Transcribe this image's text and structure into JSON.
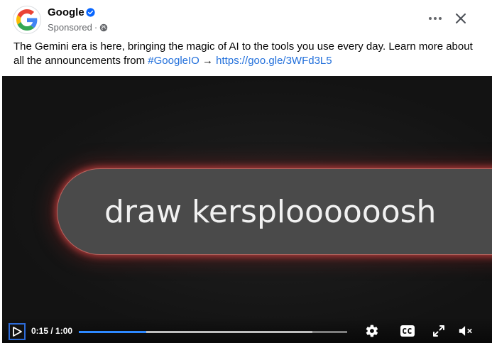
{
  "post": {
    "page_name": "Google",
    "sponsored_label": "Sponsored",
    "separator": "·",
    "message_text": "The Gemini era is here, bringing the magic of AI to the tools you use every day. Learn more about all the announcements from ",
    "hashtag": "#GoogleIO",
    "arrow": " → ",
    "link": "https://goo.gle/3WFd3L5"
  },
  "video": {
    "caption": "draw kersploooooosh",
    "current_time": "0:15",
    "duration": "1:00",
    "time_display": "0:15 / 1:00",
    "played_fraction": 0.25,
    "buffered_fraction": 0.87
  },
  "icons": {
    "avatar": "google-logo",
    "verified": "verified-badge-icon",
    "audience": "globe-icon",
    "more": "more-horizontal-icon",
    "close": "close-icon",
    "play": "play-icon",
    "settings": "gear-icon",
    "captions": "closed-captions-icon",
    "fullscreen": "fullscreen-icon",
    "volume": "volume-muted-icon"
  },
  "colors": {
    "link": "#216fdb",
    "verified": "#0866ff",
    "progress_played": "#2d88ff",
    "pill_glow": "#dc4646"
  }
}
